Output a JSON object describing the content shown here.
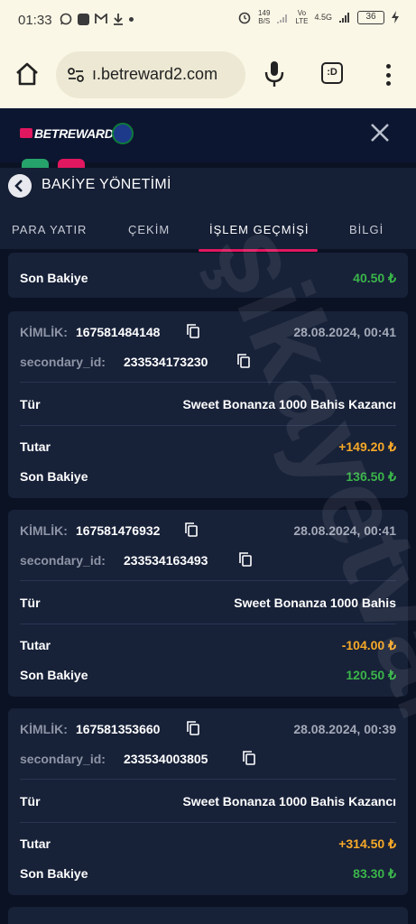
{
  "status_bar": {
    "time": "01:33",
    "net_speed_top": "149",
    "net_speed_bottom": "B/S",
    "vo_lte_top": "Vo",
    "vo_lte_bottom": "LTE",
    "network_type": "4.5G",
    "battery": "36"
  },
  "browser": {
    "url": "ı.betreward2.com",
    "tabs_icon_label": ":D"
  },
  "site": {
    "brand_prefix": "BET",
    "brand_suffix": "REWARD"
  },
  "panel": {
    "title": "BAKİYE YÖNETİMİ",
    "tabs": [
      {
        "label": "PARA YATIR"
      },
      {
        "label": "ÇEKİM"
      },
      {
        "label": "İŞLEM GEÇMİŞİ"
      },
      {
        "label": "BİLGİ"
      }
    ]
  },
  "top_partial": {
    "label": "Son Bakiye",
    "value": "40.50 ₺"
  },
  "transactions": [
    {
      "id_label": "KİMLİK:",
      "id": "167581484148",
      "date": "28.08.2024, 00:41",
      "secondary_label": "secondary_id:",
      "secondary_id": "233534173230",
      "type_label": "Tür",
      "type": "Sweet Bonanza 1000 Bahis Kazancı",
      "amount_label": "Tutar",
      "amount": "+149.20 ₺",
      "balance_label": "Son Bakiye",
      "balance": "136.50 ₺"
    },
    {
      "id_label": "KİMLİK:",
      "id": "167581476932",
      "date": "28.08.2024, 00:41",
      "secondary_label": "secondary_id:",
      "secondary_id": "233534163493",
      "type_label": "Tür",
      "type": "Sweet Bonanza 1000 Bahis",
      "amount_label": "Tutar",
      "amount": "-104.00 ₺",
      "balance_label": "Son Bakiye",
      "balance": "120.50 ₺"
    },
    {
      "id_label": "KİMLİK:",
      "id": "167581353660",
      "date": "28.08.2024, 00:39",
      "secondary_label": "secondary_id:",
      "secondary_id": "233534003805",
      "type_label": "Tür",
      "type": "Sweet Bonanza 1000 Bahis Kazancı",
      "amount_label": "Tutar",
      "amount": "+314.50 ₺",
      "balance_label": "Son Bakiye",
      "balance": "83.30 ₺"
    }
  ],
  "watermark": "şikayetvar",
  "colors": {
    "accent": "#e1175f",
    "positive": "#3bb54a",
    "amount": "#f7a928",
    "card": "#172138",
    "background": "#0b1224"
  }
}
